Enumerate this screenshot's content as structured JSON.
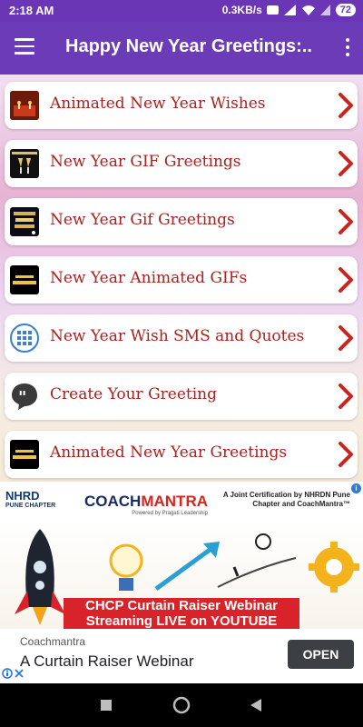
{
  "status": {
    "time": "2:18 AM",
    "speed": "0.3KB/s",
    "battery": "72"
  },
  "appbar": {
    "title": "Happy New Year Greetings:..."
  },
  "items": [
    {
      "label": "Animated New Year Wishes",
      "thumb_icon": "candles-thumbnail"
    },
    {
      "label": "New Year GIF Greetings",
      "thumb_icon": "champagne-thumbnail"
    },
    {
      "label": "New Year Gif Greetings",
      "thumb_icon": "happy-new-year-thumbnail"
    },
    {
      "label": "New Year Animated GIFs",
      "thumb_icon": "happy-new-year-text-thumbnail"
    },
    {
      "label": "New Year Wish SMS and Quotes",
      "thumb_icon": "grid-icon"
    },
    {
      "label": "Create Your Greeting",
      "thumb_icon": "quote-bubble-icon"
    },
    {
      "label": "Animated New Year Greetings",
      "thumb_icon": "happy-new-year-text-thumbnail"
    }
  ],
  "ad": {
    "banner": {
      "logo1": "NHRD",
      "logo1_sub": "PUNE CHAPTER",
      "logo2_a": "COACH",
      "logo2_b": "MANTRA",
      "logo2_sub": "Powered by Pragati Leadership",
      "cert": "A Joint Certification by NHRDN Pune Chapter and CoachMantra™",
      "webinar": "CHCP Curtain Raiser Webinar Streaming LIVE on YOUTUBE"
    },
    "advertiser": "Coachmantra",
    "headline": "A Curtain Raiser Webinar",
    "cta": "OPEN"
  },
  "colors": {
    "appbar": "#6c3cb8",
    "label": "#a8221c",
    "chevron": "#c8261c"
  }
}
